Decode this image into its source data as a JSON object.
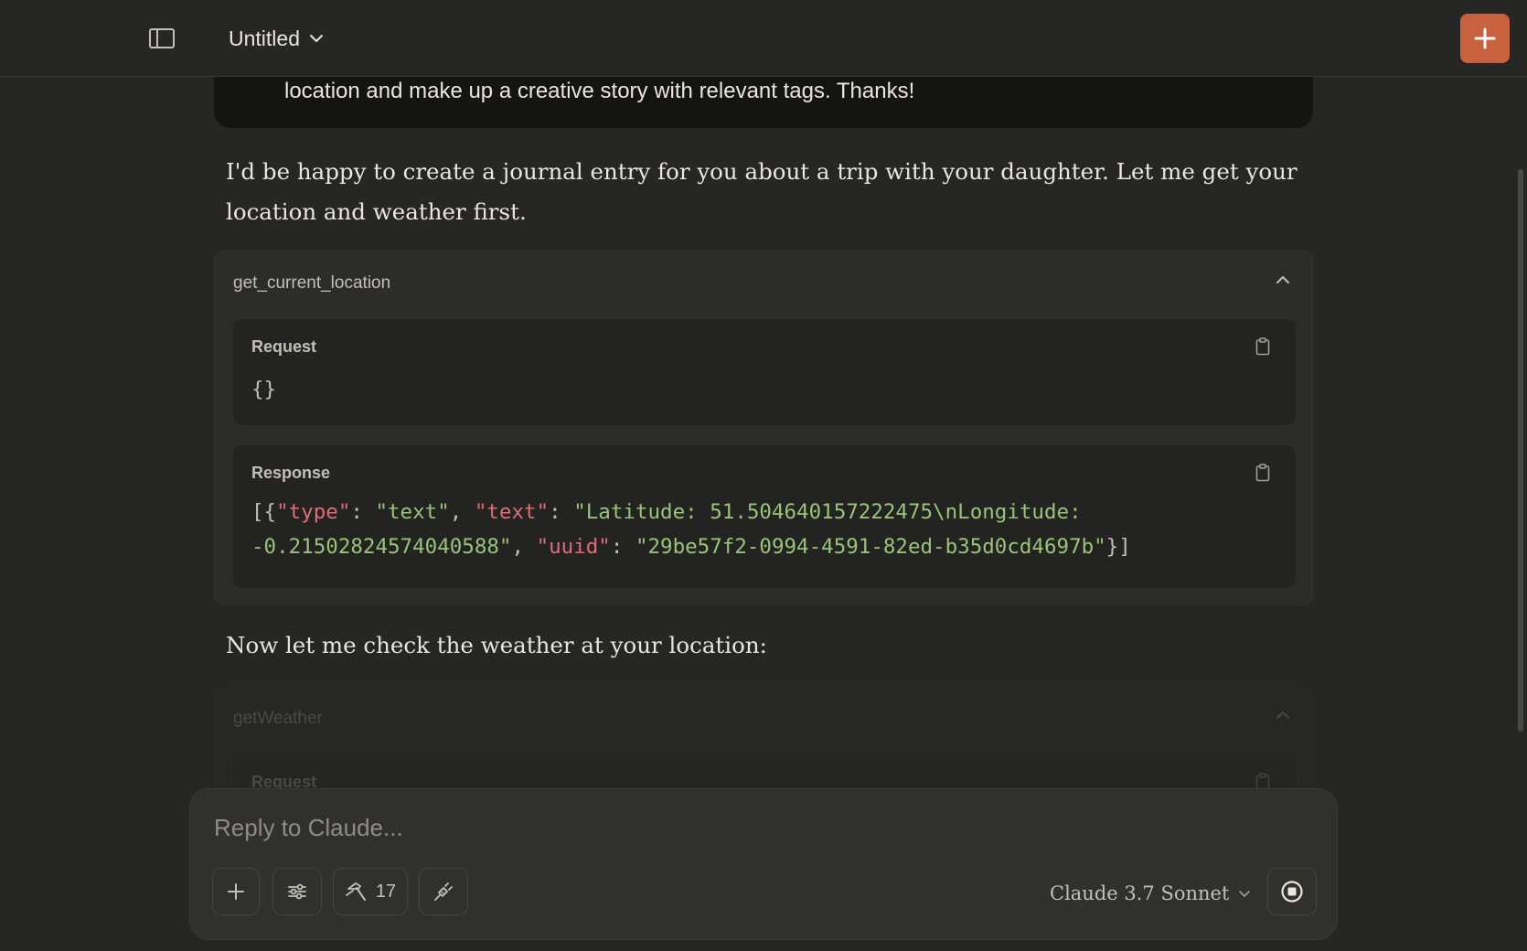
{
  "header": {
    "title": "Untitled"
  },
  "conversation": {
    "user_message_tail": "location and make up a creative story with relevant tags. Thanks!",
    "assistant_intro_line1": "I'd be happy to create a journal entry for you about a trip with your daughter. Let me get your",
    "assistant_intro_line2": "location and weather first.",
    "tool_call_1": {
      "name": "get_current_location",
      "request_label": "Request",
      "request_body": "{}",
      "response_label": "Response",
      "response": {
        "t_open": "[{",
        "t_key_type": "\"type\"",
        "t_colon1": ": ",
        "t_val_text1": "\"text\"",
        "t_comma1": ", ",
        "t_key_text": "\"text\"",
        "t_colon2": ": ",
        "t_val_lat": "\"Latitude: 51.504640157222475\\nLongitude:",
        "t_val_lon": "-0.21502824574040588\"",
        "t_comma2": ", ",
        "t_key_uuid": "\"uuid\"",
        "t_colon3": ": ",
        "t_val_uuid": "\"29be57f2-0994-4591-82ed-b35d0cd4697b\"",
        "t_close": "}]"
      }
    },
    "assistant_weather_line": "Now let me check the weather at your location:",
    "tool_call_2": {
      "name": "getWeather",
      "request_label": "Request"
    }
  },
  "composer": {
    "placeholder": "Reply to Claude...",
    "tools_count": "17",
    "model_name": "Claude 3.7 Sonnet"
  },
  "colors": {
    "accent": "#c8613d",
    "background": "#262624",
    "json_key": "#e06c75",
    "json_string": "#98c379"
  },
  "icons": {
    "sidebar": "sidebar-toggle-icon",
    "title_dropdown": "chevron-down-icon",
    "new_chat": "plus-icon",
    "collapse": "chevron-up-icon",
    "copy": "clipboard-icon",
    "attach": "plus-icon",
    "settings": "sliders-icon",
    "tools": "hammer-icon",
    "integrations": "plug-icon",
    "model_dropdown": "chevron-down-icon",
    "stop": "stop-circle-icon"
  }
}
